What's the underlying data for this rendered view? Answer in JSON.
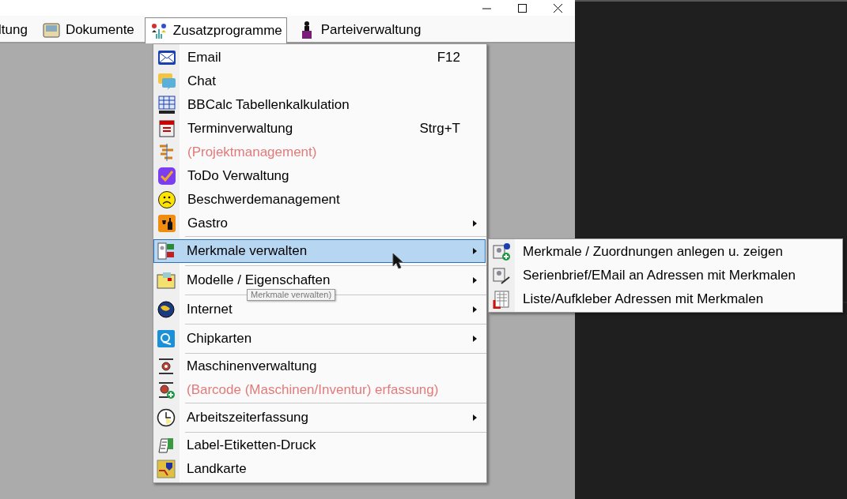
{
  "menubar": [
    {
      "label": "ltung",
      "open": false
    },
    {
      "label": "Dokumente",
      "open": false
    },
    {
      "label": "Zusatzprogramme",
      "open": true
    },
    {
      "label": "Parteiverwaltung",
      "open": false
    }
  ],
  "menu": {
    "groups": [
      {
        "items": [
          {
            "label": "Email",
            "shortcut": "F12",
            "disabled": false,
            "selected": false,
            "submenu": false
          },
          {
            "label": "Chat",
            "disabled": false,
            "selected": false,
            "submenu": false
          },
          {
            "label": "BBCalc Tabellenkalkulation",
            "disabled": false,
            "selected": false,
            "submenu": false
          },
          {
            "label": "Terminverwaltung",
            "shortcut": "Strg+T",
            "disabled": false,
            "selected": false,
            "submenu": false
          },
          {
            "label": "(Projektmanagement)",
            "disabled": true,
            "selected": false,
            "submenu": false
          },
          {
            "label": "ToDo Verwaltung",
            "disabled": false,
            "selected": false,
            "submenu": false
          },
          {
            "label": "Beschwerdemanagement",
            "disabled": false,
            "selected": false,
            "submenu": false
          },
          {
            "label": "Gastro",
            "disabled": false,
            "selected": false,
            "submenu": true
          }
        ]
      },
      {
        "items": [
          {
            "label": "Merkmale verwalten",
            "disabled": false,
            "selected": true,
            "submenu": true
          }
        ]
      },
      {
        "items": [
          {
            "label": "Modelle / Eigenschaften",
            "disabled": false,
            "selected": false,
            "submenu": true
          }
        ]
      },
      {
        "items": [
          {
            "label": "Internet",
            "disabled": false,
            "selected": false,
            "submenu": true
          }
        ]
      },
      {
        "items": [
          {
            "label": "Chipkarten",
            "disabled": false,
            "selected": false,
            "submenu": true
          }
        ]
      },
      {
        "items": [
          {
            "label": "Maschinenverwaltung",
            "disabled": false,
            "selected": false,
            "submenu": false
          },
          {
            "label": "(Barcode (Maschinen/Inventur) erfassung)",
            "disabled": true,
            "selected": false,
            "submenu": false
          }
        ]
      },
      {
        "items": [
          {
            "label": "Arbeitszeiterfassung",
            "disabled": false,
            "selected": false,
            "submenu": true
          }
        ]
      },
      {
        "items": [
          {
            "label": "Label-Etiketten-Druck",
            "disabled": false,
            "selected": false,
            "submenu": false
          },
          {
            "label": "Landkarte",
            "disabled": false,
            "selected": false,
            "submenu": false
          }
        ]
      }
    ]
  },
  "tooltip": {
    "text": "Merkmale verwalten)"
  },
  "submenu": {
    "items": [
      {
        "label": "Merkmale / Zuordnungen anlegen u. zeigen"
      },
      {
        "label": "Serienbrief/EMail an Adressen mit Merkmalen"
      },
      {
        "label": "Liste/Aufkleber Adressen mit Merkmalen"
      }
    ]
  }
}
